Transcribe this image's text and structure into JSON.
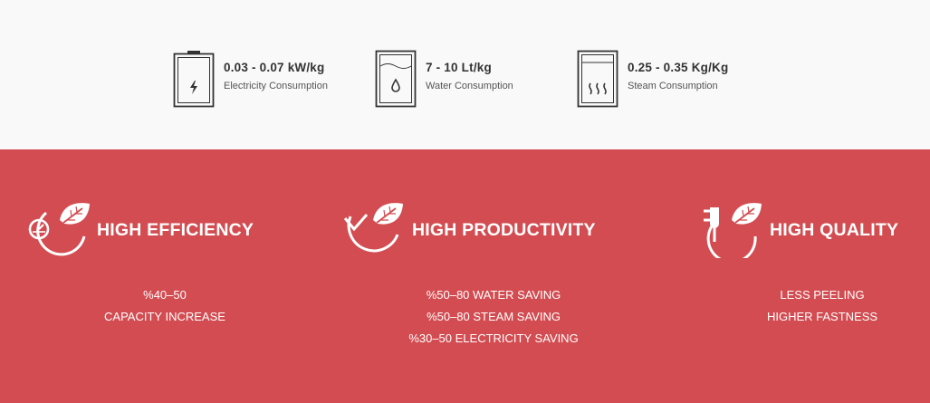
{
  "consumption": [
    {
      "icon": "battery-icon",
      "value": "0.03 - 0.07 kW/kg",
      "label": "Electricity Consumption"
    },
    {
      "icon": "water-tank-icon",
      "value": "7 - 10 Lt/kg",
      "label": "Water Consumption"
    },
    {
      "icon": "steam-tank-icon",
      "value": "0.25 - 0.35 Kg/Kg",
      "label": "Steam Consumption"
    }
  ],
  "features": [
    {
      "icon": "gauge-leaf-icon",
      "title": "HIGH EFFICIENCY",
      "lines": [
        "%40–50",
        "CAPACITY INCREASE"
      ]
    },
    {
      "icon": "check-leaf-icon",
      "title": "HIGH PRODUCTIVITY",
      "lines": [
        "%50–80 WATER SAVING",
        "%50–80 STEAM SAVING",
        "%30–50 ELECTRICITY SAVING"
      ]
    },
    {
      "icon": "plug-leaf-icon",
      "title": "HIGH QUALITY",
      "lines": [
        "LESS PEELING",
        "HIGHER FASTNESS"
      ]
    }
  ],
  "colors": {
    "accent": "#d34c51",
    "background": "#f9f9f9",
    "text": "#333333"
  }
}
